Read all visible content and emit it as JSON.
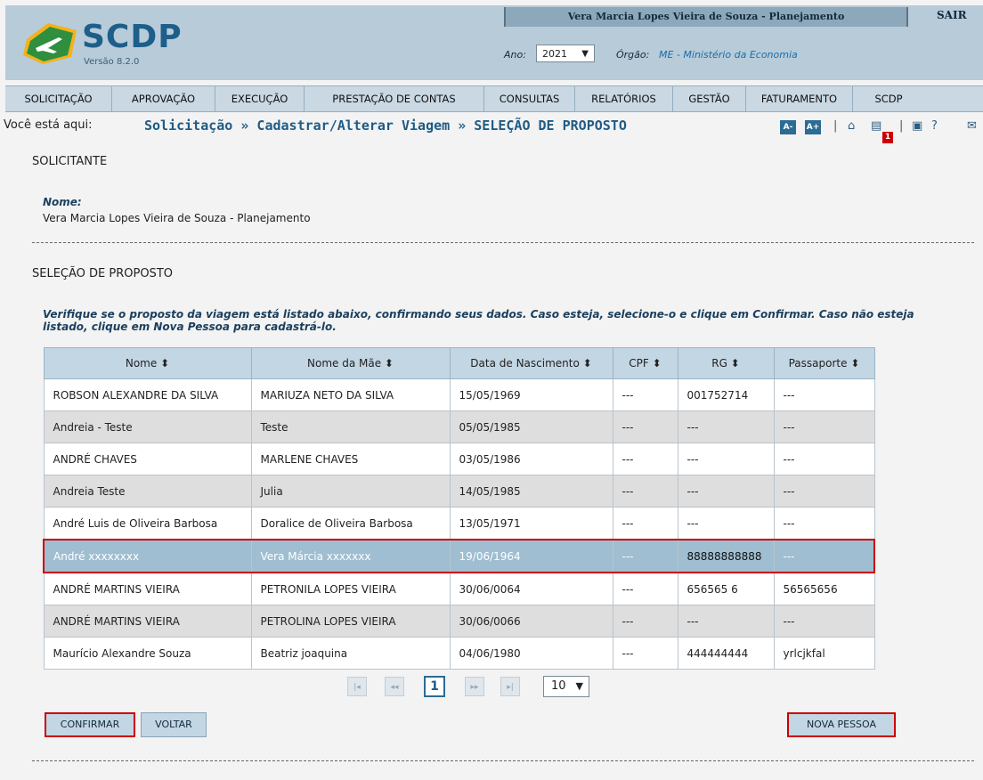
{
  "app": {
    "logo_text": "SCDP",
    "version": "Versão 8.2.0",
    "user": "Vera Marcia Lopes Vieira de Souza - Planejamento",
    "logout": "SAIR",
    "ano_label": "Ano:",
    "ano_value": "2021",
    "orgao_label": "Órgão:",
    "orgao_value": "ME - Ministério da Economia"
  },
  "nav": [
    "SOLICITAÇÃO",
    "APROVAÇÃO",
    "EXECUÇÃO",
    "PRESTAÇÃO DE CONTAS",
    "CONSULTAS",
    "RELATÓRIOS",
    "GESTÃO",
    "FATURAMENTO",
    "SCDP"
  ],
  "breadcrumb": {
    "prefix": "Você está aqui:",
    "path": "Solicitação » Cadastrar/Alterar Viagem » SELEÇÃO DE PROPOSTO",
    "font_decrease": "A-",
    "font_increase": "A+",
    "notification_count": "1"
  },
  "solicitante": {
    "title": "SOLICITANTE",
    "nome_label": "Nome:",
    "nome_value": "Vera Marcia Lopes Vieira de Souza - Planejamento"
  },
  "selecao": {
    "title": "SELEÇÃO DE PROPOSTO",
    "instructions": "Verifique se o proposto da viagem está listado abaixo, confirmando seus dados. Caso esteja, selecione-o e clique em Confirmar. Caso não esteja listado, clique em Nova Pessoa para cadastrá-lo."
  },
  "table": {
    "headers": [
      "Nome ⬍",
      "Nome da Mãe ⬍",
      "Data de Nascimento ⬍",
      "CPF ⬍",
      "RG ⬍",
      "Passaporte ⬍"
    ],
    "rows": [
      [
        "ROBSON ALEXANDRE DA SILVA",
        "MARIUZA NETO DA SILVA",
        "15/05/1969",
        "---",
        "001752714",
        "---"
      ],
      [
        "Andreia - Teste",
        "Teste",
        "05/05/1985",
        "---",
        "---",
        "---"
      ],
      [
        "ANDRÉ CHAVES",
        "MARLENE CHAVES",
        "03/05/1986",
        "---",
        "---",
        "---"
      ],
      [
        "Andreia Teste",
        "Julia",
        "14/05/1985",
        "---",
        "---",
        "---"
      ],
      [
        "André Luis de Oliveira Barbosa",
        "Doralice de Oliveira Barbosa",
        "13/05/1971",
        "---",
        "---",
        "---"
      ],
      [
        "André xxxxxxxx",
        "Vera Márcia xxxxxxx",
        "19/06/1964",
        "---",
        "88888888888",
        "---"
      ],
      [
        "ANDRÉ MARTINS VIEIRA",
        "PETRONILA LOPES VIEIRA",
        "30/06/0064",
        "---",
        "656565 6",
        "56565656"
      ],
      [
        "ANDRÉ MARTINS VIEIRA",
        "PETROLINA LOPES VIEIRA",
        "30/06/0066",
        "---",
        "---",
        "---"
      ],
      [
        "Maurício Alexandre Souza",
        "Beatriz joaquina",
        "04/06/1980",
        "---",
        "444444444",
        "yrlcjkfal"
      ]
    ]
  },
  "pagination": {
    "first": "|◂",
    "prev": "◂◂",
    "current": "1",
    "next": "▸▸",
    "last": "▸|",
    "page_size": "10"
  },
  "buttons": {
    "confirm": "CONFIRMAR",
    "back": "VOLTAR",
    "new_person": "NOVA PESSOA"
  }
}
